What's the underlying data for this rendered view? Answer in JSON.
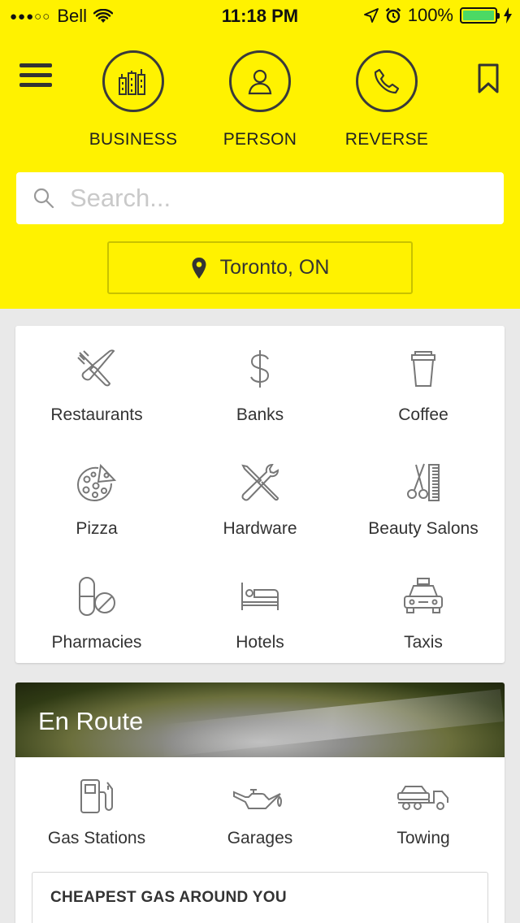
{
  "status_bar": {
    "signal_dots": "●●●○○",
    "carrier": "Bell",
    "time": "11:18 PM",
    "battery_percent": "100%",
    "battery_level": 1.0,
    "battery_color": "#4cd964"
  },
  "header": {
    "background_color": "#fff200",
    "menu_icon": "hamburger-menu-icon",
    "bookmark_icon": "bookmark-icon",
    "modes": [
      {
        "label": "BUSINESS",
        "icon": "buildings-icon"
      },
      {
        "label": "PERSON",
        "icon": "person-icon"
      },
      {
        "label": "REVERSE",
        "icon": "phone-icon"
      }
    ]
  },
  "search": {
    "placeholder": "Search...",
    "value": "",
    "icon": "search-icon"
  },
  "location": {
    "label": "Toronto, ON",
    "icon": "location-pin-icon"
  },
  "categories": [
    {
      "label": "Restaurants",
      "icon": "fork-knife-icon"
    },
    {
      "label": "Banks",
      "icon": "dollar-icon"
    },
    {
      "label": "Coffee",
      "icon": "coffee-cup-icon"
    },
    {
      "label": "Pizza",
      "icon": "pizza-icon"
    },
    {
      "label": "Hardware",
      "icon": "tools-icon"
    },
    {
      "label": "Beauty Salons",
      "icon": "scissors-comb-icon"
    },
    {
      "label": "Pharmacies",
      "icon": "pills-icon"
    },
    {
      "label": "Hotels",
      "icon": "bed-icon"
    },
    {
      "label": "Taxis",
      "icon": "taxi-icon"
    }
  ],
  "en_route": {
    "title": "En Route",
    "items": [
      {
        "label": "Gas Stations",
        "icon": "gas-pump-icon"
      },
      {
        "label": "Garages",
        "icon": "oil-can-icon"
      },
      {
        "label": "Towing",
        "icon": "tow-truck-icon"
      }
    ],
    "cheapest_gas_label": "CHEAPEST GAS AROUND YOU"
  }
}
